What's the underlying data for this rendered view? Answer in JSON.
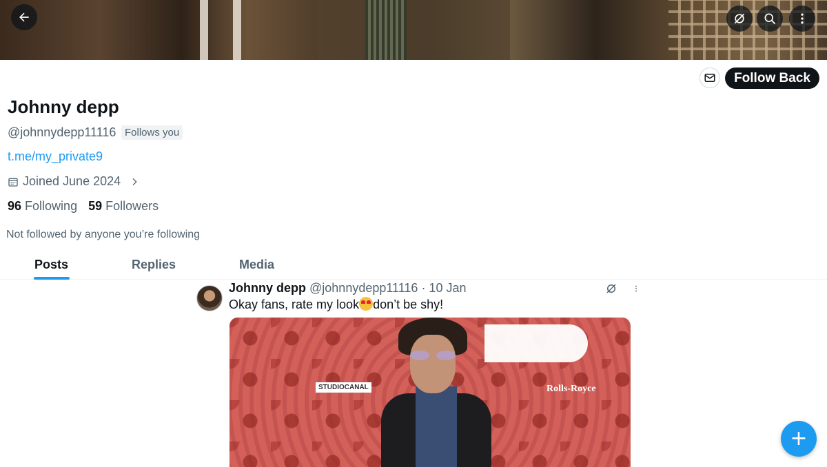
{
  "profile": {
    "name": "Johnny depp",
    "handle": "@johnnydepp11116",
    "follows_you": "Follows you",
    "link": "t.me/my_private9",
    "joined": "Joined June 2024",
    "following_count": "96",
    "following_label": "Following",
    "followers_count": "59",
    "followers_label": "Followers",
    "not_followed": "Not followed by anyone you’re following"
  },
  "actions": {
    "follow_back": "Follow Back"
  },
  "tabs": [
    {
      "label": "Posts",
      "active": true
    },
    {
      "label": "Replies",
      "active": false
    },
    {
      "label": "Media",
      "active": false
    }
  ],
  "post": {
    "author": "Johnny depp",
    "handle": "@johnnydepp11116",
    "date": "· 10 Jan",
    "text_before": "Okay fans, rate my look",
    "text_after": "don’t be shy!",
    "image_logos": {
      "studio": "STUDIOCANAL",
      "brand": "Rolls-Royce"
    }
  },
  "colors": {
    "accent": "#1d9bf0",
    "text": "#0f1419",
    "secondary": "#536471"
  },
  "icons": [
    "back-arrow-icon",
    "grok-icon",
    "search-icon",
    "more-vertical-icon",
    "mail-icon",
    "calendar-icon",
    "chevron-right-icon",
    "plus-icon"
  ]
}
